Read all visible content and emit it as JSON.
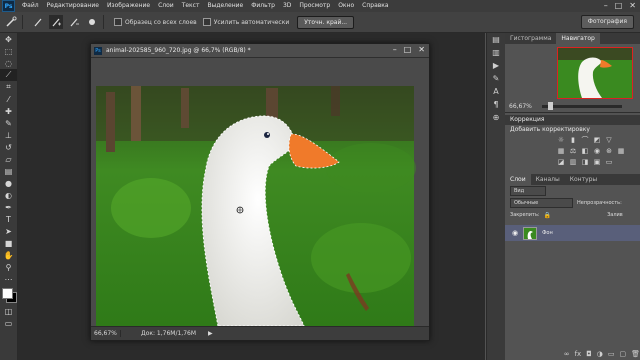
{
  "app": {
    "logo": "Ps"
  },
  "menu": [
    "Файл",
    "Редактирование",
    "Изображение",
    "Слои",
    "Текст",
    "Выделение",
    "Фильтр",
    "3D",
    "Просмотр",
    "Окно",
    "Справка"
  ],
  "window_controls": [
    "–",
    "□",
    "✕"
  ],
  "options": {
    "sample_all_layers": "Образец со всех слоев",
    "auto_enhance": "Усилить автоматически",
    "refine_edge": "Уточн. край...",
    "workspace": "Фотография"
  },
  "document": {
    "title": "animal-202585_960_720.jpg @ 66,7% (RGB/8) *",
    "zoom": "66,67%",
    "doc_info": "Док: 1,76M/1,76M",
    "controls": [
      "–",
      "□",
      "✕"
    ]
  },
  "panels": {
    "top_tabs": [
      "Гистограмма",
      "Навигатор"
    ],
    "nav_zoom": "66,67%",
    "corrections_title": "Коррекция",
    "corrections_sub": "Добавить корректировку",
    "layers_tabs": [
      "Слои",
      "Каналы",
      "Контуры"
    ],
    "kind_filter": "Вид",
    "blend_mode": "Обычные",
    "opacity_label": "Непрозрачность:",
    "lock_label": "Закрепить:",
    "fill_label": "Залив",
    "layer_name": "Фон"
  },
  "colors": {
    "accent": "#31a8ff",
    "selected_layer": "#595f7a"
  }
}
